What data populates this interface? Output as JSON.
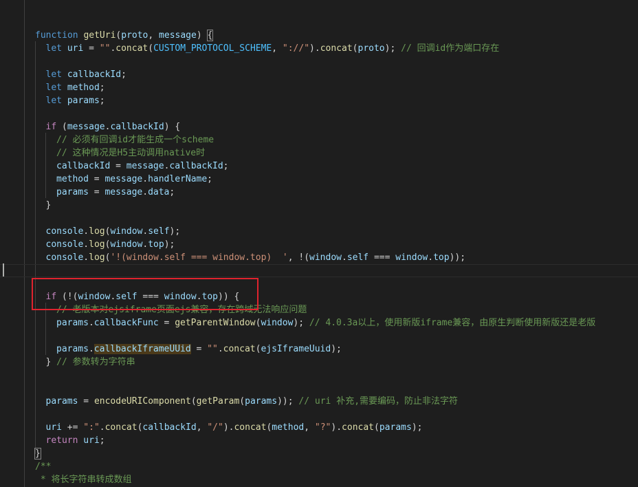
{
  "editor": {
    "lines": [
      {
        "indent": 0,
        "tokens": []
      },
      {
        "indent": 0,
        "tokens": []
      },
      {
        "indent": 0,
        "tokens": [
          {
            "t": "function",
            "c": "kw"
          },
          {
            "t": " ",
            "c": "pun"
          },
          {
            "t": "getUri",
            "c": "fn"
          },
          {
            "t": "(",
            "c": "pun"
          },
          {
            "t": "proto",
            "c": "var"
          },
          {
            "t": ", ",
            "c": "pun"
          },
          {
            "t": "message",
            "c": "var"
          },
          {
            "t": ") ",
            "c": "pun"
          },
          {
            "t": "{",
            "c": "pun brk"
          }
        ]
      },
      {
        "indent": 1,
        "tokens": [
          {
            "t": "let",
            "c": "kw"
          },
          {
            "t": " ",
            "c": "pun"
          },
          {
            "t": "uri",
            "c": "var"
          },
          {
            "t": " = ",
            "c": "pun"
          },
          {
            "t": "\"\"",
            "c": "str"
          },
          {
            "t": ".",
            "c": "pun"
          },
          {
            "t": "concat",
            "c": "fn"
          },
          {
            "t": "(",
            "c": "pun"
          },
          {
            "t": "CUSTOM_PROTOCOL_SCHEME",
            "c": "const"
          },
          {
            "t": ", ",
            "c": "pun"
          },
          {
            "t": "\"://\"",
            "c": "str"
          },
          {
            "t": ").",
            "c": "pun"
          },
          {
            "t": "concat",
            "c": "fn"
          },
          {
            "t": "(",
            "c": "pun"
          },
          {
            "t": "proto",
            "c": "var"
          },
          {
            "t": "); ",
            "c": "pun"
          },
          {
            "t": "// 回调id作为端口存在",
            "c": "cmt"
          }
        ]
      },
      {
        "indent": 1,
        "tokens": []
      },
      {
        "indent": 1,
        "tokens": [
          {
            "t": "let",
            "c": "kw"
          },
          {
            "t": " ",
            "c": "pun"
          },
          {
            "t": "callbackId",
            "c": "var"
          },
          {
            "t": ";",
            "c": "pun"
          }
        ]
      },
      {
        "indent": 1,
        "tokens": [
          {
            "t": "let",
            "c": "kw"
          },
          {
            "t": " ",
            "c": "pun"
          },
          {
            "t": "method",
            "c": "var"
          },
          {
            "t": ";",
            "c": "pun"
          }
        ]
      },
      {
        "indent": 1,
        "tokens": [
          {
            "t": "let",
            "c": "kw"
          },
          {
            "t": " ",
            "c": "pun"
          },
          {
            "t": "params",
            "c": "var"
          },
          {
            "t": ";",
            "c": "pun"
          }
        ]
      },
      {
        "indent": 1,
        "tokens": []
      },
      {
        "indent": 1,
        "tokens": [
          {
            "t": "if",
            "c": "ctl"
          },
          {
            "t": " (",
            "c": "pun"
          },
          {
            "t": "message",
            "c": "var"
          },
          {
            "t": ".",
            "c": "pun"
          },
          {
            "t": "callbackId",
            "c": "var"
          },
          {
            "t": ") {",
            "c": "pun"
          }
        ]
      },
      {
        "indent": 2,
        "tokens": [
          {
            "t": "// 必须有回调id才能生成一个scheme",
            "c": "cmt"
          }
        ]
      },
      {
        "indent": 2,
        "tokens": [
          {
            "t": "// 这种情况是H5主动调用native时",
            "c": "cmt"
          }
        ]
      },
      {
        "indent": 2,
        "tokens": [
          {
            "t": "callbackId",
            "c": "var"
          },
          {
            "t": " = ",
            "c": "pun"
          },
          {
            "t": "message",
            "c": "var"
          },
          {
            "t": ".",
            "c": "pun"
          },
          {
            "t": "callbackId",
            "c": "var"
          },
          {
            "t": ";",
            "c": "pun"
          }
        ]
      },
      {
        "indent": 2,
        "tokens": [
          {
            "t": "method",
            "c": "var"
          },
          {
            "t": " = ",
            "c": "pun"
          },
          {
            "t": "message",
            "c": "var"
          },
          {
            "t": ".",
            "c": "pun"
          },
          {
            "t": "handlerName",
            "c": "var"
          },
          {
            "t": ";",
            "c": "pun"
          }
        ]
      },
      {
        "indent": 2,
        "tokens": [
          {
            "t": "params",
            "c": "var"
          },
          {
            "t": " = ",
            "c": "pun"
          },
          {
            "t": "message",
            "c": "var"
          },
          {
            "t": ".",
            "c": "pun"
          },
          {
            "t": "data",
            "c": "var"
          },
          {
            "t": ";",
            "c": "pun"
          }
        ]
      },
      {
        "indent": 1,
        "tokens": [
          {
            "t": "}",
            "c": "pun"
          }
        ]
      },
      {
        "indent": 1,
        "tokens": []
      },
      {
        "indent": 1,
        "tokens": [
          {
            "t": "console",
            "c": "var"
          },
          {
            "t": ".",
            "c": "pun"
          },
          {
            "t": "log",
            "c": "fn"
          },
          {
            "t": "(",
            "c": "pun"
          },
          {
            "t": "window",
            "c": "var"
          },
          {
            "t": ".",
            "c": "pun"
          },
          {
            "t": "self",
            "c": "var"
          },
          {
            "t": ");",
            "c": "pun"
          }
        ]
      },
      {
        "indent": 1,
        "tokens": [
          {
            "t": "console",
            "c": "var"
          },
          {
            "t": ".",
            "c": "pun"
          },
          {
            "t": "log",
            "c": "fn"
          },
          {
            "t": "(",
            "c": "pun"
          },
          {
            "t": "window",
            "c": "var"
          },
          {
            "t": ".",
            "c": "pun"
          },
          {
            "t": "top",
            "c": "var"
          },
          {
            "t": ");",
            "c": "pun"
          }
        ]
      },
      {
        "indent": 1,
        "tokens": [
          {
            "t": "console",
            "c": "var"
          },
          {
            "t": ".",
            "c": "pun"
          },
          {
            "t": "log",
            "c": "fn"
          },
          {
            "t": "(",
            "c": "pun"
          },
          {
            "t": "'!(window.self === window.top)  '",
            "c": "str"
          },
          {
            "t": ", !(",
            "c": "pun"
          },
          {
            "t": "window",
            "c": "var"
          },
          {
            "t": ".",
            "c": "pun"
          },
          {
            "t": "self",
            "c": "var"
          },
          {
            "t": " === ",
            "c": "pun"
          },
          {
            "t": "window",
            "c": "var"
          },
          {
            "t": ".",
            "c": "pun"
          },
          {
            "t": "top",
            "c": "var"
          },
          {
            "t": "));",
            "c": "pun"
          }
        ]
      },
      {
        "indent": 0,
        "tokens": [],
        "cursor": true
      },
      {
        "indent": 1,
        "tokens": []
      },
      {
        "indent": 1,
        "tokens": [
          {
            "t": "if",
            "c": "ctl"
          },
          {
            "t": " (!(",
            "c": "pun"
          },
          {
            "t": "window",
            "c": "var"
          },
          {
            "t": ".",
            "c": "pun"
          },
          {
            "t": "self",
            "c": "var"
          },
          {
            "t": " === ",
            "c": "pun"
          },
          {
            "t": "window",
            "c": "var"
          },
          {
            "t": ".",
            "c": "pun"
          },
          {
            "t": "top",
            "c": "var"
          },
          {
            "t": ")) {",
            "c": "pun"
          }
        ]
      },
      {
        "indent": 2,
        "tokens": [
          {
            "t": "// 老版本对ejsiframe页面ejs兼容，存在跨域无法响应问题",
            "c": "cmt"
          }
        ]
      },
      {
        "indent": 2,
        "tokens": [
          {
            "t": "params",
            "c": "var"
          },
          {
            "t": ".",
            "c": "pun"
          },
          {
            "t": "callbackFunc",
            "c": "var"
          },
          {
            "t": " = ",
            "c": "pun"
          },
          {
            "t": "getParentWindow",
            "c": "fn"
          },
          {
            "t": "(",
            "c": "pun"
          },
          {
            "t": "window",
            "c": "var"
          },
          {
            "t": "); ",
            "c": "pun"
          },
          {
            "t": "// 4.0.3a以上，使用新版iframe兼容，由原生判断使用新版还是老版",
            "c": "cmt"
          }
        ]
      },
      {
        "indent": 2,
        "tokens": []
      },
      {
        "indent": 2,
        "tokens": [
          {
            "t": "params",
            "c": "var"
          },
          {
            "t": ".",
            "c": "pun"
          },
          {
            "t": "callbackIframeUUid",
            "c": "var hl-word"
          },
          {
            "t": " = ",
            "c": "pun"
          },
          {
            "t": "\"\"",
            "c": "str"
          },
          {
            "t": ".",
            "c": "pun"
          },
          {
            "t": "concat",
            "c": "fn"
          },
          {
            "t": "(",
            "c": "pun"
          },
          {
            "t": "ejsIframeUuid",
            "c": "var"
          },
          {
            "t": ");",
            "c": "pun"
          }
        ]
      },
      {
        "indent": 1,
        "tokens": [
          {
            "t": "} ",
            "c": "pun"
          },
          {
            "t": "// 参数转为字符串",
            "c": "cmt"
          }
        ]
      },
      {
        "indent": 1,
        "tokens": []
      },
      {
        "indent": 1,
        "tokens": []
      },
      {
        "indent": 1,
        "tokens": [
          {
            "t": "params",
            "c": "var"
          },
          {
            "t": " = ",
            "c": "pun"
          },
          {
            "t": "encodeURIComponent",
            "c": "fn"
          },
          {
            "t": "(",
            "c": "pun"
          },
          {
            "t": "getParam",
            "c": "fn"
          },
          {
            "t": "(",
            "c": "pun"
          },
          {
            "t": "params",
            "c": "var"
          },
          {
            "t": ")); ",
            "c": "pun"
          },
          {
            "t": "// uri 补充,需要编码，防止非法字符",
            "c": "cmt"
          }
        ]
      },
      {
        "indent": 1,
        "tokens": []
      },
      {
        "indent": 1,
        "tokens": [
          {
            "t": "uri",
            "c": "var"
          },
          {
            "t": " += ",
            "c": "pun"
          },
          {
            "t": "\":\"",
            "c": "str"
          },
          {
            "t": ".",
            "c": "pun"
          },
          {
            "t": "concat",
            "c": "fn"
          },
          {
            "t": "(",
            "c": "pun"
          },
          {
            "t": "callbackId",
            "c": "var"
          },
          {
            "t": ", ",
            "c": "pun"
          },
          {
            "t": "\"/\"",
            "c": "str"
          },
          {
            "t": ").",
            "c": "pun"
          },
          {
            "t": "concat",
            "c": "fn"
          },
          {
            "t": "(",
            "c": "pun"
          },
          {
            "t": "method",
            "c": "var"
          },
          {
            "t": ", ",
            "c": "pun"
          },
          {
            "t": "\"?\"",
            "c": "str"
          },
          {
            "t": ").",
            "c": "pun"
          },
          {
            "t": "concat",
            "c": "fn"
          },
          {
            "t": "(",
            "c": "pun"
          },
          {
            "t": "params",
            "c": "var"
          },
          {
            "t": ");",
            "c": "pun"
          }
        ]
      },
      {
        "indent": 1,
        "tokens": [
          {
            "t": "return",
            "c": "ctl"
          },
          {
            "t": " ",
            "c": "pun"
          },
          {
            "t": "uri",
            "c": "var"
          },
          {
            "t": ";",
            "c": "pun"
          }
        ]
      },
      {
        "indent": 0,
        "tokens": [
          {
            "t": "}",
            "c": "pun brk"
          }
        ]
      },
      {
        "indent": 0,
        "tokens": [
          {
            "t": "/**",
            "c": "cmt"
          }
        ]
      },
      {
        "indent": 0,
        "tokens": [
          {
            "t": " * 将长字符串转成数组",
            "c": "cmt"
          }
        ]
      }
    ]
  }
}
